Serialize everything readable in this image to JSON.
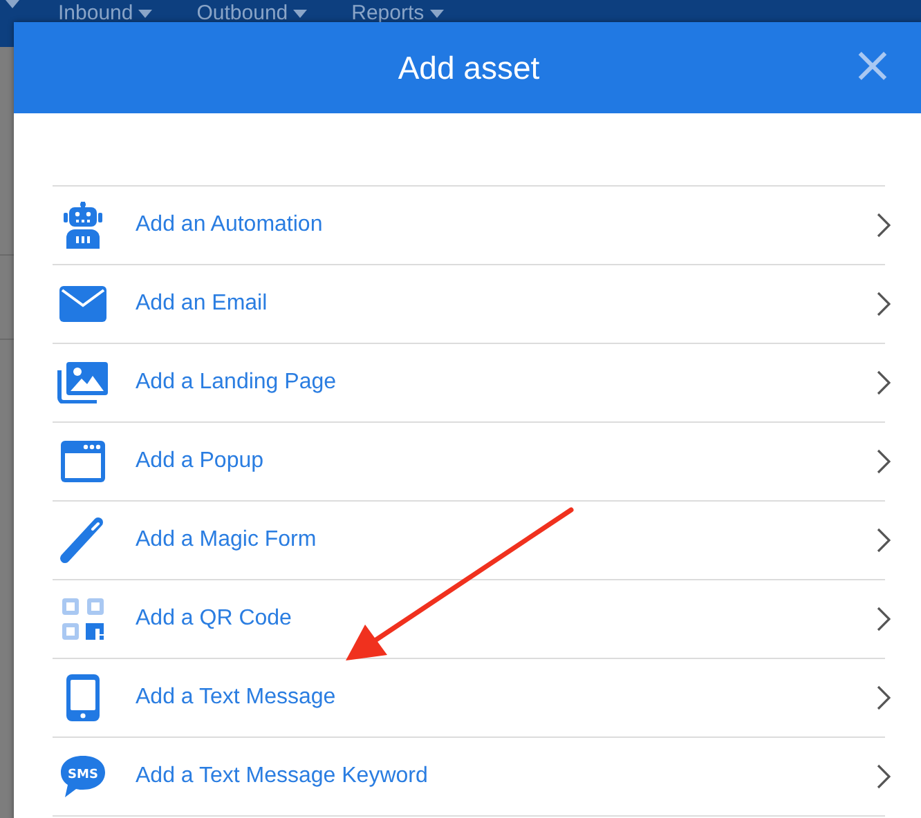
{
  "nav": {
    "items": [
      {
        "label": "Inbound"
      },
      {
        "label": "Outbound"
      },
      {
        "label": "Reports"
      }
    ]
  },
  "dialog": {
    "title": "Add asset",
    "close": "×",
    "items": [
      {
        "kind": "robot",
        "label": "Add an Automation"
      },
      {
        "kind": "envelope",
        "label": "Add an Email"
      },
      {
        "kind": "images",
        "label": "Add a Landing Page"
      },
      {
        "kind": "window",
        "label": "Add a Popup"
      },
      {
        "kind": "wand",
        "label": "Add a Magic Form"
      },
      {
        "kind": "qr",
        "label": "Add a QR Code"
      },
      {
        "kind": "phone",
        "label": "Add a Text Message"
      },
      {
        "kind": "bubble",
        "label": "Add a Text Message Keyword",
        "badge": "SMS"
      }
    ]
  }
}
